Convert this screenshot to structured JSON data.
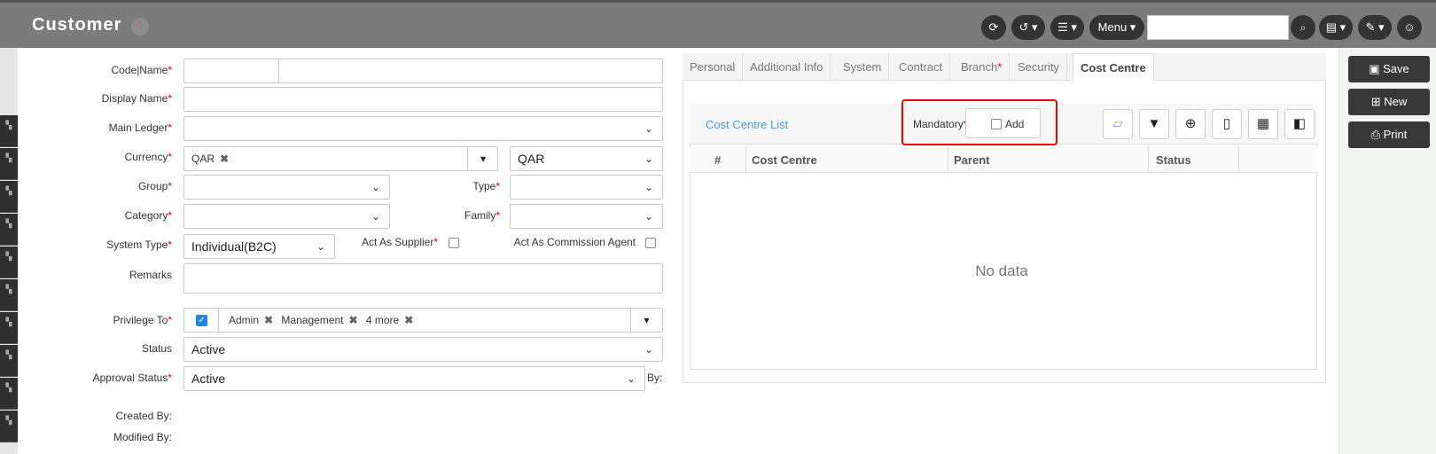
{
  "header": {
    "title": "Customer",
    "menu_label": "Menu",
    "search_placeholder": ""
  },
  "form": {
    "code_name_label": "Code|Name",
    "display_name_label": "Display Name",
    "main_ledger_label": "Main Ledger",
    "currency_label": "Currency",
    "currency_tag": "QAR",
    "currency_select": "QAR",
    "group_label": "Group",
    "type_label": "Type",
    "category_label": "Category",
    "family_label": "Family",
    "system_type_label": "System Type",
    "system_type_value": "Individual(B2C)",
    "act_as_supplier_label": "Act As Supplier",
    "act_as_commission_label": "Act As Commission Agent",
    "remarks_label": "Remarks",
    "privilege_label": "Privilege To",
    "privilege_tags": [
      "Admin",
      "Management",
      "4 more"
    ],
    "status_label": "Status",
    "status_value": "Active",
    "approval_label": "Approval Status",
    "approval_value": "Active",
    "by_label": "By:",
    "created_by_label": "Created By:",
    "modified_by_label": "Modified By:",
    "required_mark": "*"
  },
  "tabs": [
    "Personal",
    "Additional Info",
    "System",
    "Contract",
    "Branch",
    "Security",
    "Cost Centre"
  ],
  "branch_required": "*",
  "active_tab": "Cost Centre",
  "cost_centre": {
    "list_title": "Cost Centre List",
    "mandatory_label": "Mandatory",
    "add_label": "Add",
    "columns": [
      "#",
      "Cost Centre",
      "Parent",
      "Status"
    ],
    "empty_text": "No data"
  },
  "actions": {
    "save": "Save",
    "new": "New",
    "print": "Print"
  },
  "colors": {
    "header_bg": "#7b7b7b",
    "accent_link": "#4a9bd6",
    "highlight": "#e00000"
  }
}
